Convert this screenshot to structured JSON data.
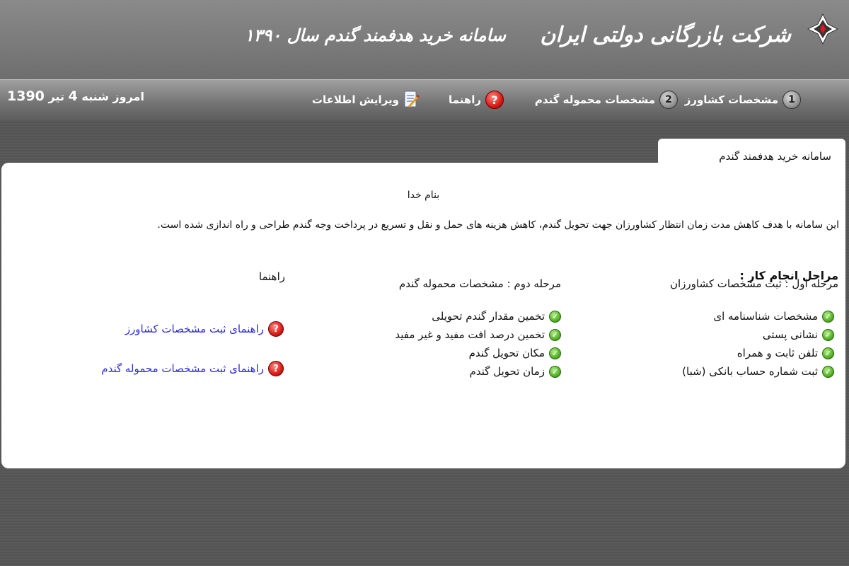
{
  "header": {
    "company_name": "شرکت بازرگانی دولتی ایران",
    "system_title": "سامانه خرید هدفمند گندم سال ۱۳۹۰"
  },
  "nav": {
    "items": [
      {
        "number": "1",
        "label": "مشخصات کشاورز"
      },
      {
        "number": "2",
        "label": "مشخصات محموله گندم"
      },
      {
        "label": "راهنما"
      },
      {
        "label": "ویرایش اطلاعات"
      }
    ],
    "date_prefix": "امروز شنبه",
    "date_day": "4",
    "date_month": "تیر",
    "date_year": "1390"
  },
  "main": {
    "tab_label": "سامانه خرید هدفمند گندم",
    "basmala": "بنام خدا",
    "intro": "این سامانه با هدف کاهش مدت زمان انتظار کشاورزان جهت تحویل گندم، کاهش هزینه های حمل و نقل و تسریع در پرداخت وجه گندم طراحی و راه اندازی شده است.",
    "steps_heading": "مراحل انجام کار :",
    "step1": {
      "title": "مرحله اول : ثبت مشخصات کشاورزان",
      "items": [
        "مشخصات شناسنامه ای",
        "نشانی پستی",
        "تلفن ثابت و همراه",
        "ثبت شماره حساب بانکی (شبا)"
      ]
    },
    "step2": {
      "title": "مرحله دوم : مشخصات محموله گندم",
      "items": [
        "تخمین مقدار گندم تحویلی",
        "تخمین درصد افت مفید و غیر مفید",
        "مکان تحویل گندم",
        "زمان تحویل گندم"
      ]
    },
    "help": {
      "title": "راهنما",
      "links": [
        "راهنمای ثبت مشخصات کشاورز",
        "راهنمای ثبت مشخصات محموله گندم"
      ]
    }
  }
}
